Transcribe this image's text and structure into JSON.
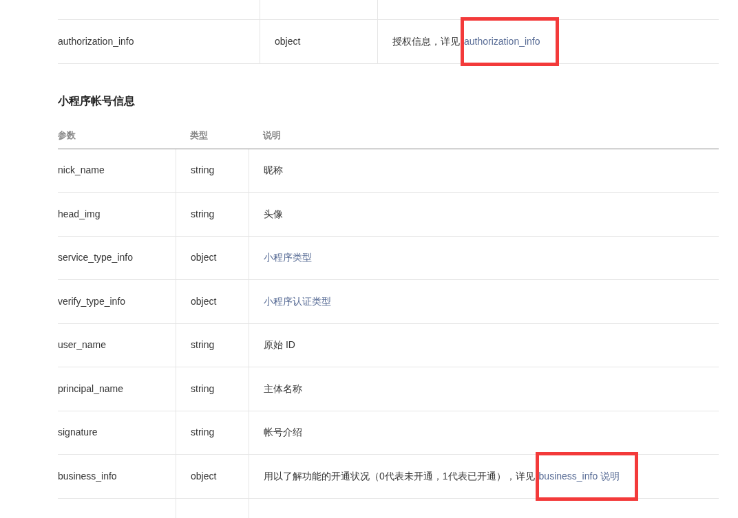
{
  "tables": [
    {
      "rows": [
        {
          "param": "authorization_info",
          "type": "object",
          "description": [
            {
              "text": "授权信息，详见"
            },
            {
              "text": "authorization_info",
              "link": true,
              "highlighted": true
            }
          ]
        }
      ]
    },
    {
      "title": "小程序帐号信息",
      "columns": [
        "参数",
        "类型",
        "说明"
      ],
      "rows": [
        {
          "param": "nick_name",
          "type": "string",
          "description": [
            {
              "text": "昵称"
            }
          ]
        },
        {
          "param": "head_img",
          "type": "string",
          "description": [
            {
              "text": "头像"
            }
          ]
        },
        {
          "param": "service_type_info",
          "type": "object",
          "description": [
            {
              "text": "小程序类型",
              "link": true
            }
          ]
        },
        {
          "param": "verify_type_info",
          "type": "object",
          "description": [
            {
              "text": "小程序认证类型",
              "link": true
            }
          ]
        },
        {
          "param": "user_name",
          "type": "string",
          "description": [
            {
              "text": "原始 ID"
            }
          ]
        },
        {
          "param": "principal_name",
          "type": "string",
          "description": [
            {
              "text": "主体名称"
            }
          ]
        },
        {
          "param": "signature",
          "type": "string",
          "description": [
            {
              "text": "帐号介绍"
            }
          ]
        },
        {
          "param": "business_info",
          "type": "object",
          "description": [
            {
              "text": "用以了解功能的开通状况（0代表未开通，1代表已开通），详见"
            },
            {
              "text": "business_info 说明",
              "link": true,
              "highlighted": true
            }
          ]
        }
      ]
    }
  ]
}
